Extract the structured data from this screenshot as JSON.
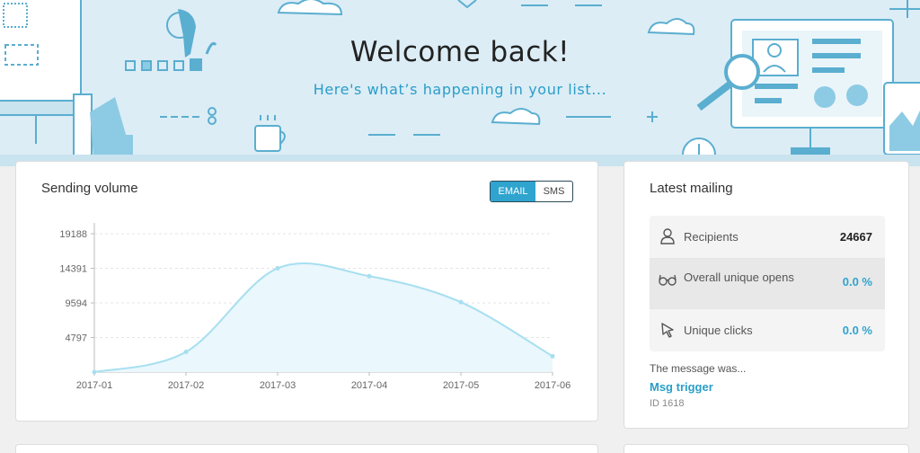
{
  "hero": {
    "title": "Welcome back!",
    "subtitle": "Here's what’s happening in your list..."
  },
  "sending_volume": {
    "title": "Sending volume",
    "toggle": {
      "email_label": "EMAIL",
      "sms_label": "SMS",
      "active": "EMAIL"
    }
  },
  "chart_data": {
    "type": "area",
    "x": [
      "2017-01",
      "2017-02",
      "2017-03",
      "2017-04",
      "2017-05",
      "2017-06"
    ],
    "values": [
      0,
      2800,
      14400,
      13300,
      9700,
      2200
    ],
    "ytick_labels": [
      "4797",
      "9594",
      "14391",
      "19188"
    ],
    "ylim": [
      0,
      19188
    ],
    "grid": true,
    "color": "#a6dff0"
  },
  "latest_mailing": {
    "title": "Latest mailing",
    "stats": [
      {
        "label": "Recipients",
        "value": "24667",
        "icon": "user-icon"
      },
      {
        "label": "Overall unique opens",
        "value": "0.0 %",
        "icon": "glasses-icon"
      },
      {
        "label": "Unique clicks",
        "value": "0.0 %",
        "icon": "cursor-icon"
      }
    ],
    "message_was": "The message was...",
    "message_name": "Msg trigger",
    "message_id": "ID 1618"
  },
  "colors": {
    "accent": "#2fa4cf",
    "hero_bg": "#dcedf6"
  }
}
